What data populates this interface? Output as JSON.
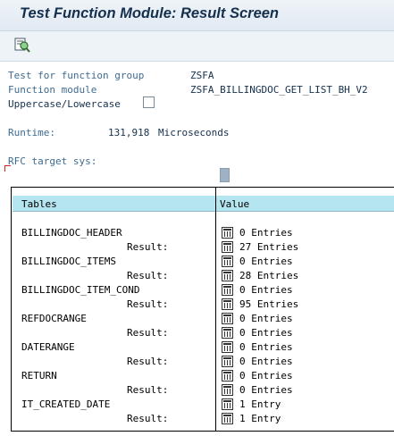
{
  "window": {
    "title": "Test Function Module: Result Screen"
  },
  "toolbar": {
    "buttons": [
      {
        "icon": "execute-inspect-icon"
      }
    ]
  },
  "info": {
    "test_for_label": "Test for function group",
    "test_for_value": "ZSFA",
    "fm_label": "Function module",
    "fm_value": "ZSFA_BILLINGDOC_GET_LIST_BH_V2",
    "case_label": "Uppercase/Lowercase",
    "case_checked": false,
    "runtime_label": "Runtime:",
    "runtime_value": "131,918",
    "runtime_unit": "Microseconds",
    "rfc_label": "RFC target sys:"
  },
  "table": {
    "col_tables": "Tables",
    "col_value": "Value",
    "result_label": "Result:",
    "rows": [
      {
        "name": "BILLINGDOC_HEADER",
        "input": "0 Entries",
        "result": "27 Entries"
      },
      {
        "name": "BILLINGDOC_ITEMS",
        "input": "0 Entries",
        "result": "28 Entries"
      },
      {
        "name": "BILLINGDOC_ITEM_COND",
        "input": "0 Entries",
        "result": "95 Entries"
      },
      {
        "name": "REFDOCRANGE",
        "input": "0 Entries",
        "result": "0 Entries"
      },
      {
        "name": "DATERANGE",
        "input": "0 Entries",
        "result": "0 Entries"
      },
      {
        "name": "RETURN",
        "input": "0 Entries",
        "result": "0 Entries"
      },
      {
        "name": "IT_CREATED_DATE",
        "input": "1 Entry",
        "result": "1 Entry"
      }
    ]
  }
}
